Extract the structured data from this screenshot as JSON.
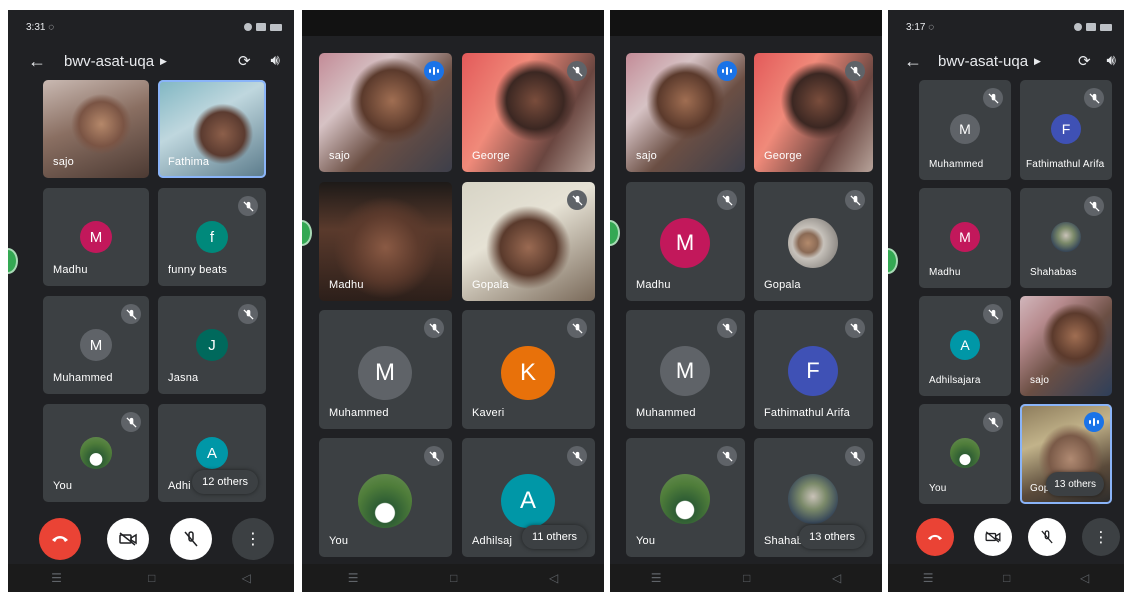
{
  "colors": {
    "bg": "#202124",
    "tile": "#3c4043",
    "end_call": "#ea4335",
    "speaking": "#1a73e8"
  },
  "status_bar": {
    "time_1": "3:31",
    "time_4": "3:17"
  },
  "meeting": {
    "code": "bwv-asat-uqa"
  },
  "panel1": {
    "video_tiles": [
      {
        "name": "sajo"
      },
      {
        "name": "Fathima"
      }
    ],
    "tiles": [
      {
        "initial": "M",
        "name": "Madhu",
        "color": "#c2185b"
      },
      {
        "initial": "f",
        "name": "funny beats",
        "color": "#00897b"
      },
      {
        "initial": "M",
        "name": "Muhammed",
        "color": "#5f6368"
      },
      {
        "initial": "J",
        "name": "Jasna",
        "color": "#00695c"
      },
      {
        "name": "You"
      },
      {
        "initial": "A",
        "name": "Adhi",
        "color": "#0097a7"
      }
    ],
    "others": "12 others"
  },
  "panel2": {
    "video_tiles": [
      {
        "name": "sajo"
      },
      {
        "name": "George"
      },
      {
        "name": "Madhu"
      },
      {
        "name": "Gopala"
      }
    ],
    "tiles": [
      {
        "initial": "M",
        "name": "Muhammed",
        "color": "#5f6368"
      },
      {
        "initial": "K",
        "name": "Kaveri",
        "color": "#e8710a"
      },
      {
        "name": "You"
      },
      {
        "initial": "A",
        "name": "Adhilsaj",
        "color": "#0097a7"
      }
    ],
    "others": "11 others"
  },
  "panel3": {
    "video_tiles": [
      {
        "name": "sajo"
      },
      {
        "name": "George"
      }
    ],
    "tiles": [
      {
        "initial": "M",
        "name": "Madhu",
        "color": "#c2185b"
      },
      {
        "name": "Gopala"
      },
      {
        "initial": "M",
        "name": "Muhammed",
        "color": "#5f6368"
      },
      {
        "initial": "F",
        "name": "Fathimathul Arifa",
        "color": "#3f51b5"
      },
      {
        "name": "You"
      },
      {
        "name": "Shahaba"
      }
    ],
    "others": "13 others"
  },
  "panel4": {
    "tiles": [
      {
        "initial": "M",
        "name": "Muhammed",
        "color": "#5f6368"
      },
      {
        "initial": "F",
        "name": "Fathimathul Arifa",
        "color": "#3f51b5"
      },
      {
        "initial": "M",
        "name": "Madhu",
        "color": "#c2185b"
      },
      {
        "name": "Shahabas"
      },
      {
        "initial": "A",
        "name": "Adhilsajara",
        "color": "#0097a7"
      },
      {
        "name": "sajo"
      },
      {
        "name": "You"
      },
      {
        "name": "Gop"
      }
    ],
    "others": "13 others"
  }
}
